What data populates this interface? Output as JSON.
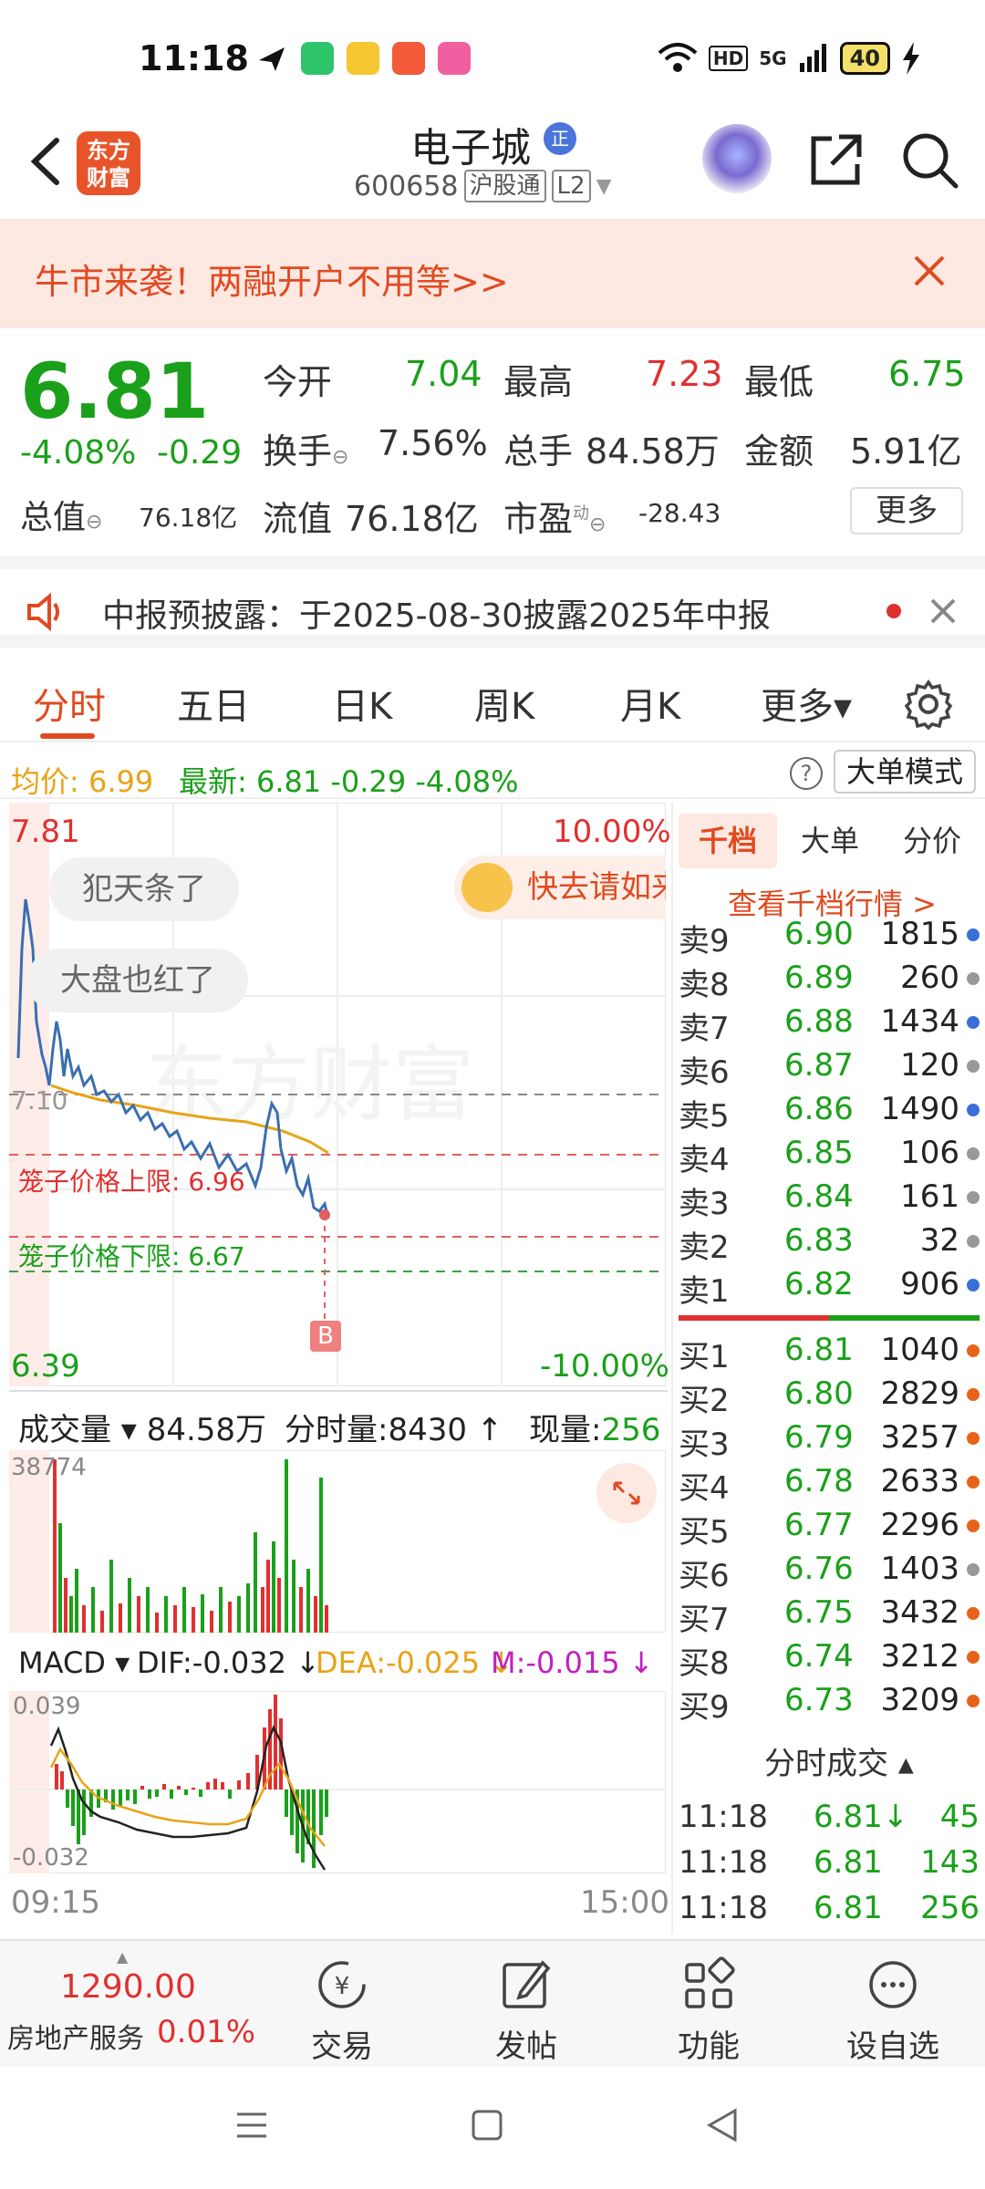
{
  "status": {
    "time": "11:18",
    "battery": "40",
    "hd": "HD",
    "net": "5G"
  },
  "header": {
    "name": "电子城",
    "rong_badge": "正",
    "code": "600658",
    "market_tag": "沪股通",
    "level_tag": "L2",
    "logo_text_1": "东方",
    "logo_text_2": "财富"
  },
  "banner": {
    "text": "牛市来袭！两融开户不用等>>"
  },
  "quote": {
    "price": "6.81",
    "change_pct": "-4.08%",
    "change": "-0.29",
    "open_label": "今开",
    "open": "7.04",
    "high_label": "最高",
    "high": "7.23",
    "low_label": "最低",
    "low": "6.75",
    "turnover_label": "换手",
    "turnover": "7.56%",
    "volume_label": "总手",
    "volume": "84.58万",
    "amount_label": "金额",
    "amount": "5.91亿",
    "mktcap_label": "总值",
    "mktcap": "76.18亿",
    "float_label": "流值",
    "float_cap": "76.18亿",
    "pe_label": "市盈",
    "pe_sup": "动",
    "pe": "-28.43",
    "more_label": "更多"
  },
  "notice": {
    "text": "中报预披露：于2025-08-30披露2025年中报"
  },
  "tabs": [
    "分时",
    "五日",
    "日K",
    "周K",
    "月K",
    "更多▾"
  ],
  "avgline": {
    "avg_label": "均价:",
    "avg": "6.99",
    "latest_text": "最新: 6.81 -0.29 -4.08%",
    "mode_label": "大单模式"
  },
  "chart": {
    "top_price": "7.81",
    "top_pct": "10.00%",
    "bottom_price": "6.39",
    "bottom_pct": "-10.00%",
    "ref_price_label": "7.10",
    "bubble1": "犯天条了",
    "bubble2": "大盘也红了",
    "promo": "快去请如来",
    "limit_up": "笼子价格上限: 6.96",
    "limit_down": "笼子价格下限: 6.67",
    "b_marker": "B",
    "watermark": "东方财富"
  },
  "volume": {
    "label": "成交量 ▾",
    "total": "84.58万",
    "minute_vol": "分时量:8430 ↑",
    "current_label": "现量:",
    "current": "256",
    "max": "38774"
  },
  "macd": {
    "label": "MACD ▾",
    "dif": "DIF:-0.032 ↓",
    "dea": "DEA:-0.025 ↓",
    "m": "M:-0.015 ↓",
    "top": "0.039",
    "bottom": "-0.032"
  },
  "time_axis": {
    "start": "09:15",
    "end": "15:00"
  },
  "order_book": {
    "tabs": [
      "千档",
      "大单",
      "分价"
    ],
    "link": "查看千档行情 >",
    "asks": [
      {
        "k": "卖9",
        "p": "6.90",
        "v": "1815",
        "c": "#3a6fd8"
      },
      {
        "k": "卖8",
        "p": "6.89",
        "v": "260",
        "c": "#999999"
      },
      {
        "k": "卖7",
        "p": "6.88",
        "v": "1434",
        "c": "#3a6fd8"
      },
      {
        "k": "卖6",
        "p": "6.87",
        "v": "120",
        "c": "#999999"
      },
      {
        "k": "卖5",
        "p": "6.86",
        "v": "1490",
        "c": "#3a6fd8"
      },
      {
        "k": "卖4",
        "p": "6.85",
        "v": "106",
        "c": "#999999"
      },
      {
        "k": "卖3",
        "p": "6.84",
        "v": "161",
        "c": "#999999"
      },
      {
        "k": "卖2",
        "p": "6.83",
        "v": "32",
        "c": "#999999"
      },
      {
        "k": "卖1",
        "p": "6.82",
        "v": "906",
        "c": "#3a6fd8"
      }
    ],
    "bids": [
      {
        "k": "买1",
        "p": "6.81",
        "v": "1040",
        "c": "#e8631a"
      },
      {
        "k": "买2",
        "p": "6.80",
        "v": "2829",
        "c": "#e8631a"
      },
      {
        "k": "买3",
        "p": "6.79",
        "v": "3257",
        "c": "#e8631a"
      },
      {
        "k": "买4",
        "p": "6.78",
        "v": "2633",
        "c": "#e8631a"
      },
      {
        "k": "买5",
        "p": "6.77",
        "v": "2296",
        "c": "#e8631a"
      },
      {
        "k": "买6",
        "p": "6.76",
        "v": "1403",
        "c": "#999999"
      },
      {
        "k": "买7",
        "p": "6.75",
        "v": "3432",
        "c": "#e8631a"
      },
      {
        "k": "买8",
        "p": "6.74",
        "v": "3212",
        "c": "#e8631a"
      },
      {
        "k": "买9",
        "p": "6.73",
        "v": "3209",
        "c": "#e8631a"
      }
    ],
    "ticks_header": "分时成交 ▴",
    "ticks": [
      {
        "t": "11:18",
        "p": "6.81↓",
        "v": "45"
      },
      {
        "t": "11:18",
        "p": "6.81",
        "v": "143"
      },
      {
        "t": "11:18",
        "p": "6.81",
        "v": "256"
      }
    ]
  },
  "bottom": {
    "index_value": "1290.00",
    "index_name": "房地产服务",
    "index_change": "0.01%",
    "items": [
      "交易",
      "发帖",
      "功能",
      "设自选"
    ]
  },
  "colors": {
    "up": "#e03030",
    "down": "#1aa01a",
    "accent": "#e04a20",
    "avg": "#e8a317",
    "price_line": "#3a6fb0"
  }
}
